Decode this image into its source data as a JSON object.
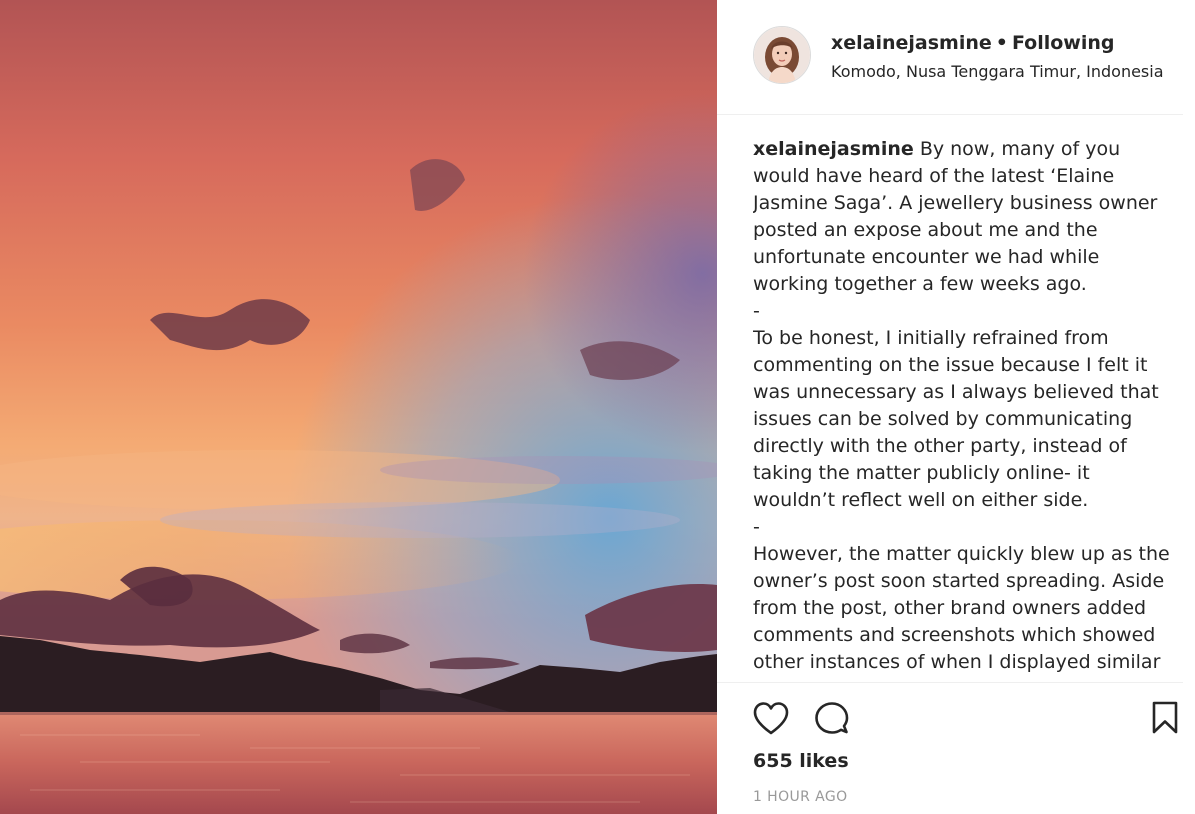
{
  "post": {
    "photo": {
      "icon": "sunset-photo",
      "colors": {
        "sky_top": "#b8575a",
        "sky_mid": "#e4775c",
        "sky_glow": "#f4b07a",
        "sky_blue": "#5f9fd0",
        "sea": "#c96a60",
        "mountains": "#2b1e22",
        "clouds": "#6b3a48"
      }
    },
    "header": {
      "username": "xelainejasmine",
      "separator": "•",
      "follow_status": "Following",
      "location": "Komodo, Nusa Tenggara Timur, Indonesia"
    },
    "caption": {
      "username": "xelainejasmine",
      "text": " By now, many of you would have heard of the latest ‘Elaine Jasmine Saga’. A jewellery business owner posted an expose about me and the unfortunate encounter we had while working together a few weeks ago.\n-\nTo be honest, I initially refrained from commenting on the issue because I felt it was unnecessary as I always believed that issues can be solved by communicating directly with the other party, instead of taking the matter publicly online- it wouldn’t reflect well on either side.\n-\nHowever, the matter quickly blew up as the owner’s post soon started spreading. Aside from the post, other brand owners added comments and screenshots which showed other instances of when I displayed similar behaviour."
    },
    "actions": {
      "like_icon": "heart-icon",
      "comment_icon": "comment-icon",
      "save_icon": "bookmark-icon"
    },
    "likes": "655 likes",
    "timestamp": "1 HOUR AGO"
  }
}
